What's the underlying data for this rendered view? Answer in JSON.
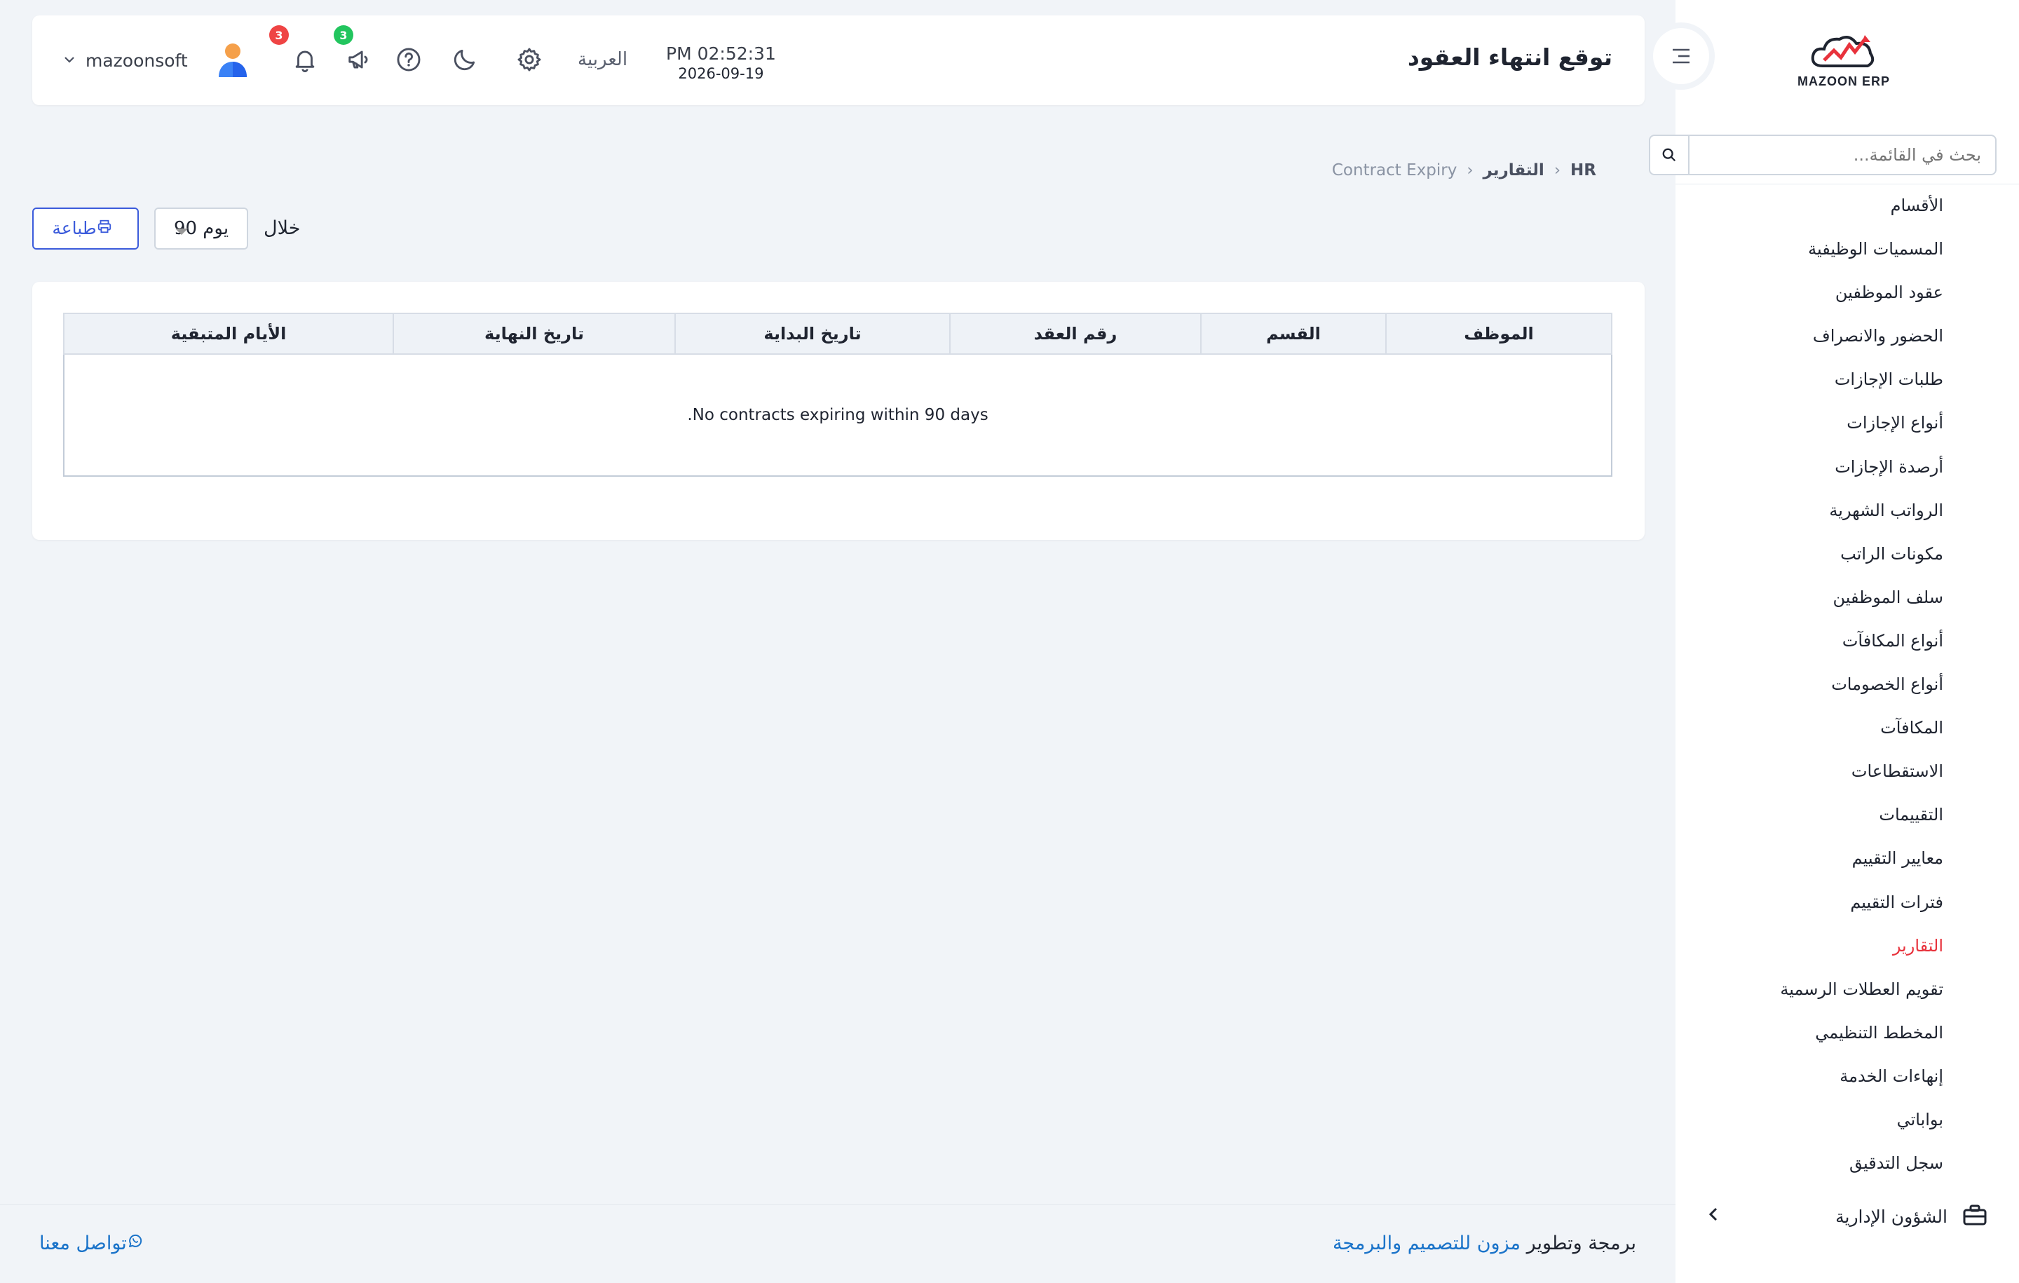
{
  "sidebar": {
    "logo_text": "MAZOON ERP",
    "search_placeholder": "بحث في القائمة...",
    "items": [
      {
        "label": "الأقسام"
      },
      {
        "label": "المسميات الوظيفية"
      },
      {
        "label": "عقود الموظفين"
      },
      {
        "label": "الحضور والانصراف"
      },
      {
        "label": "طلبات الإجازات"
      },
      {
        "label": "أنواع الإجازات"
      },
      {
        "label": "أرصدة الإجازات"
      },
      {
        "label": "الرواتب الشهرية"
      },
      {
        "label": "مكونات الراتب"
      },
      {
        "label": "سلف الموظفين"
      },
      {
        "label": "أنواع المكافآت"
      },
      {
        "label": "أنواع الخصومات"
      },
      {
        "label": "المكافآت"
      },
      {
        "label": "الاستقطاعات"
      },
      {
        "label": "التقييمات"
      },
      {
        "label": "معايير التقييم"
      },
      {
        "label": "فترات التقييم"
      },
      {
        "label": "التقارير"
      },
      {
        "label": "تقويم العطلات الرسمية"
      },
      {
        "label": "المخطط التنظيمي"
      },
      {
        "label": "إنهاءات الخدمة"
      },
      {
        "label": "بواباتي"
      },
      {
        "label": "سجل التدقيق"
      }
    ],
    "active_item": "التقارير",
    "admin_section": "الشؤون الإدارية"
  },
  "header": {
    "title": "توقع انتهاء العقود",
    "time": "PM 02:52:31",
    "date": "2026-09-19",
    "language": "العربية",
    "notifications_count": "3",
    "announcements_count": "3",
    "username": "mazoonsoft"
  },
  "breadcrumb": {
    "root": "HR",
    "section": "التقارير",
    "current": "Contract Expiry"
  },
  "toolbar": {
    "within_label": "خلال",
    "days_value": "90 يوم",
    "print_label": "طباعة"
  },
  "table": {
    "columns": [
      "الموظف",
      "القسم",
      "رقم العقد",
      "تاريخ البداية",
      "تاريخ النهاية",
      "الأيام المتبقية"
    ],
    "empty_message": "No contracts expiring within 90 days."
  },
  "footer": {
    "credit_prefix": "برمجة وتطوير",
    "credit_brand": "مزون للتصميم والبرمجة",
    "contact_label": "تواصل معنا"
  },
  "colors": {
    "accent": "#3b5bdb",
    "active_menu": "#e8323c",
    "badge_red": "#ef4444",
    "badge_green": "#22c55e",
    "link": "#1a73c9"
  }
}
